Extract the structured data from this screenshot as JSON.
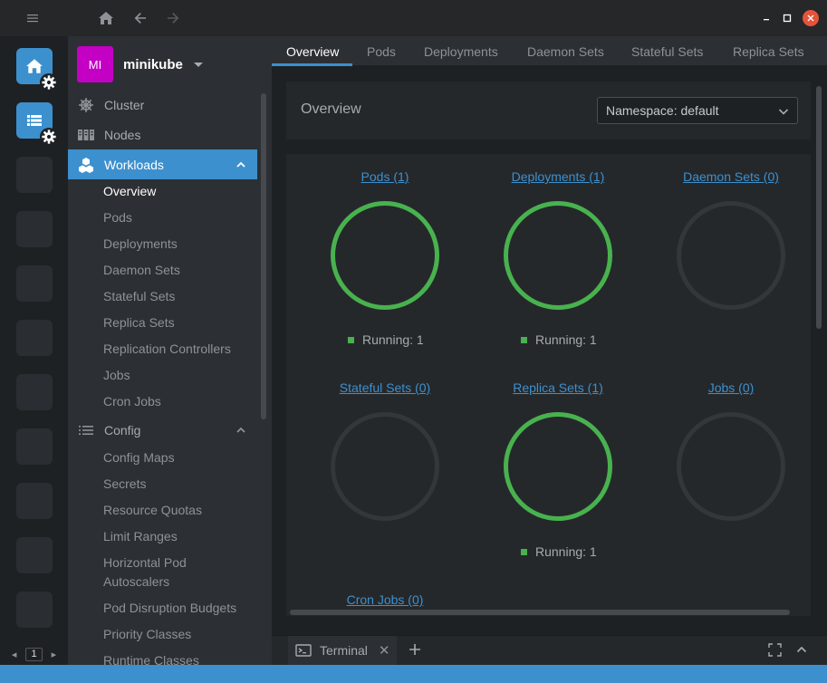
{
  "titlebar": {
    "icons": [
      "menu-icon",
      "home-icon",
      "back-arrow-icon",
      "forward-arrow-icon"
    ],
    "window_controls": [
      "minimize-icon",
      "maximize-icon",
      "close-icon"
    ]
  },
  "hotbar": {
    "items": [
      "home-icon",
      "catalog-icon"
    ],
    "page_number": "1"
  },
  "sidebar": {
    "avatar_initials": "MI",
    "avatar_color": "#c400c4",
    "cluster_name": "minikube",
    "nav": [
      {
        "label": "Cluster",
        "icon": "helm-icon"
      },
      {
        "label": "Nodes",
        "icon": "nodes-icon"
      },
      {
        "label": "Workloads",
        "icon": "workloads-icon"
      },
      {
        "label": "Config",
        "icon": "list-icon"
      }
    ],
    "workloads_items": [
      "Overview",
      "Pods",
      "Deployments",
      "Daemon Sets",
      "Stateful Sets",
      "Replica Sets",
      "Replication Controllers",
      "Jobs",
      "Cron Jobs"
    ],
    "config_items": [
      "Config Maps",
      "Secrets",
      "Resource Quotas",
      "Limit Ranges",
      "Horizontal Pod Autoscalers",
      "Pod Disruption Budgets",
      "Priority Classes",
      "Runtime Classes"
    ]
  },
  "tabs": [
    "Overview",
    "Pods",
    "Deployments",
    "Daemon Sets",
    "Stateful Sets",
    "Replica Sets"
  ],
  "overview": {
    "title": "Overview",
    "namespace_select": "Namespace: default",
    "cards": [
      {
        "title": "Pods (1)",
        "legend": "Running: 1"
      },
      {
        "title": "Deployments (1)",
        "legend": "Running: 1"
      },
      {
        "title": "Daemon Sets (0)",
        "legend": ""
      },
      {
        "title": "Stateful Sets (0)",
        "legend": ""
      },
      {
        "title": "Replica Sets (1)",
        "legend": "Running: 1"
      },
      {
        "title": "Jobs (0)",
        "legend": ""
      },
      {
        "title": "Cron Jobs (0)",
        "legend": ""
      }
    ]
  },
  "dock": {
    "terminal_label": "Terminal"
  },
  "colors": {
    "accent": "#3d90ce",
    "running": "#48b24e",
    "close": "#e5533a"
  }
}
